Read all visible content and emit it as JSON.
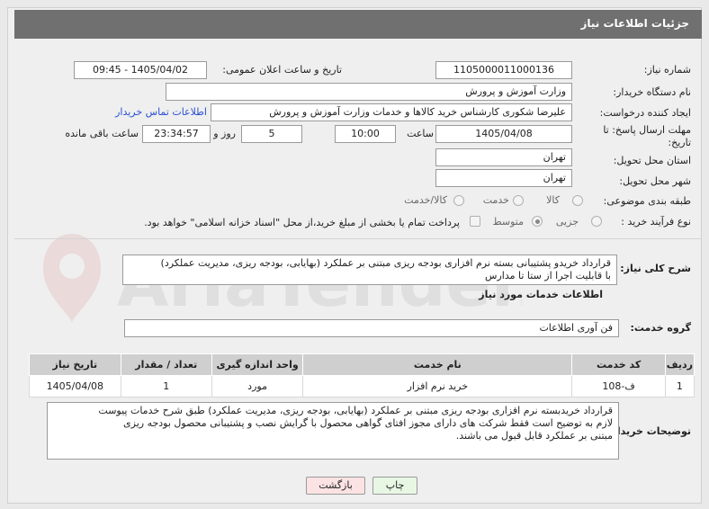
{
  "header": {
    "title": "جزئیات اطلاعات نیاز"
  },
  "fields": {
    "need_number_label": "شماره نیاز:",
    "need_number": "1105000011000136",
    "announce_label": "تاریخ و ساعت اعلان عمومی:",
    "announce_value": "1405/04/02 - 09:45",
    "buyer_org_label": "نام دستگاه خریدار:",
    "buyer_org": "وزارت آموزش و پرورش",
    "creator_label": "ایجاد کننده درخواست:",
    "creator": "علیرضا شکوری کارشناس خرید کالاها و خدمات وزارت آموزش و پرورش",
    "contact_link": "اطلاعات تماس خریدار",
    "deadline_label_1": "مهلت ارسال پاسخ: تا",
    "deadline_label_2": "تاریخ:",
    "deadline_date": "1405/04/08",
    "time_label": "ساعت",
    "deadline_time": "10:00",
    "days_value": "5",
    "days_label": "روز و",
    "remaining_time": "23:34:57",
    "remaining_label": "ساعت باقی مانده",
    "province_label": "استان محل تحویل:",
    "province": "تهران",
    "city_label": "شهر محل تحویل:",
    "city": "تهران",
    "category_label": "طبقه بندی موضوعی:",
    "category_options": [
      "کالا",
      "خدمت",
      "کالا/خدمت"
    ],
    "purchase_type_label": "نوع فرآیند خرید :",
    "purchase_options": [
      "جزیی",
      "متوسط"
    ],
    "payment_note": "پرداخت تمام یا بخشی از مبلغ خرید،از محل \"اسناد خزانه اسلامی\" خواهد بود."
  },
  "description": {
    "label": "شرح کلی نیاز:",
    "text_line1": "قرارداد خریدو پشتیبانی بسته نرم افزاری بودجه ریزی مبتنی بر عملکرد (بهایابی، بودجه ریزی، مدیریت عملکرد)",
    "text_line2": "با قابلیت اجرا از ستا تا مدارس"
  },
  "services": {
    "section_title": "اطلاعات خدمات مورد نیاز",
    "group_label": "گروه خدمت:",
    "group_value": "فن آوری اطلاعات",
    "columns": [
      "ردیف",
      "کد خدمت",
      "نام خدمت",
      "واحد اندازه گیری",
      "تعداد / مقدار",
      "تاریخ نیاز"
    ],
    "rows": [
      [
        "1",
        "ف-108",
        "خرید نرم افزار",
        "مورد",
        "1",
        "1405/04/08"
      ]
    ]
  },
  "buyer_notes": {
    "label": "توضیحات خریدار:",
    "line1": "قرارداد خریدبسته نرم افزاری بودجه ریزی مبتنی بر عملکرد (بهایابی، بودجه ریزی، مدیریت عملکرد) طبق شرح خدمات پیوست",
    "line2": "لازم به توضیح است فقط شرکت های دارای مجوز افتای گواهی محصول  با گرایش نصب و پشتیبانی محصول بودجه ریزی",
    "line3": "مبتنی بر عملکرد قابل قبول می باشند."
  },
  "buttons": {
    "print": "چاپ",
    "back": "بازگشت"
  },
  "colors": {
    "header_bg": "#707070",
    "link": "#2b4fd4",
    "print_bg": "#e8f7e4",
    "back_bg": "#fbe3e3"
  }
}
